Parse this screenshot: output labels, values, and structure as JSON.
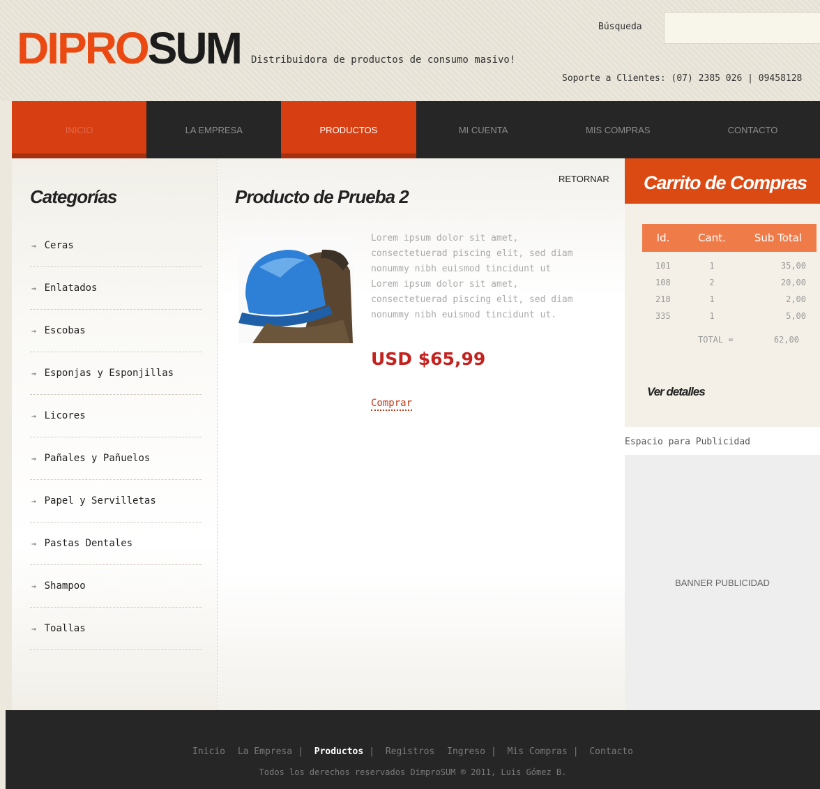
{
  "header": {
    "logo_part1": "DIPRO",
    "logo_part2": "SUM",
    "tagline": "Distribuidora de productos de consumo masivo!",
    "search_label": "Búsqueda",
    "search_placeholder": "",
    "support_text": "Soporte a Clientes: (07) 2385 026 | 09458128"
  },
  "nav": {
    "items": [
      {
        "label": "Inicio"
      },
      {
        "label": "La Empresa"
      },
      {
        "label": "Productos"
      },
      {
        "label": "Mi Cuenta"
      },
      {
        "label": "Mis Compras"
      },
      {
        "label": "Contacto"
      }
    ]
  },
  "sidebar": {
    "title": "Categorías",
    "categories": [
      "Ceras",
      "Enlatados",
      "Escobas",
      "Esponjas y Esponjillas",
      "Licores",
      "Pañales y Pañuelos",
      "Papel y Servilletas",
      "Pastas Dentales",
      "Shampoo",
      "Toallas"
    ],
    "arrow": "→"
  },
  "product": {
    "title": "Producto de Prueba 2",
    "back_label": "RETORNAR",
    "description": "Lorem ipsum dolor sit amet, consectetuerad piscing elit, sed diam nonummy nibh euismod tincidunt ut Lorem ipsum dolor sit amet, consectetuerad piscing elit, sed diam nonummy nibh euismod tincidunt ut.",
    "price": "USD $65,99",
    "buy_label": "Comprar"
  },
  "cart": {
    "title": "Carrito de Compras",
    "headers": [
      "Id.",
      "Cant.",
      "Sub Total"
    ],
    "rows": [
      [
        "101",
        "1",
        "35,00"
      ],
      [
        "108",
        "2",
        "20,00"
      ],
      [
        "218",
        "1",
        "2,00"
      ],
      [
        "335",
        "1",
        "5,00"
      ]
    ],
    "total_label": "TOTAL =",
    "total_value": "62,00",
    "details_label": "Ver detalles"
  },
  "ads": {
    "label": "Espacio para Publicidad",
    "banner_text": "BANNER PUBLICIDAD"
  },
  "footer": {
    "links": [
      "Inicio",
      "La Empresa",
      "Productos",
      "Registros",
      "Ingreso",
      "Mis Compras",
      "Contacto"
    ],
    "copyright": "Todos los derechos reservados DimproSUM ® 2011, Luis Gómez B."
  },
  "colors": {
    "brand_orange": "#ea4a12",
    "nav_active": "#d73f12",
    "price_red": "#c4221f"
  }
}
